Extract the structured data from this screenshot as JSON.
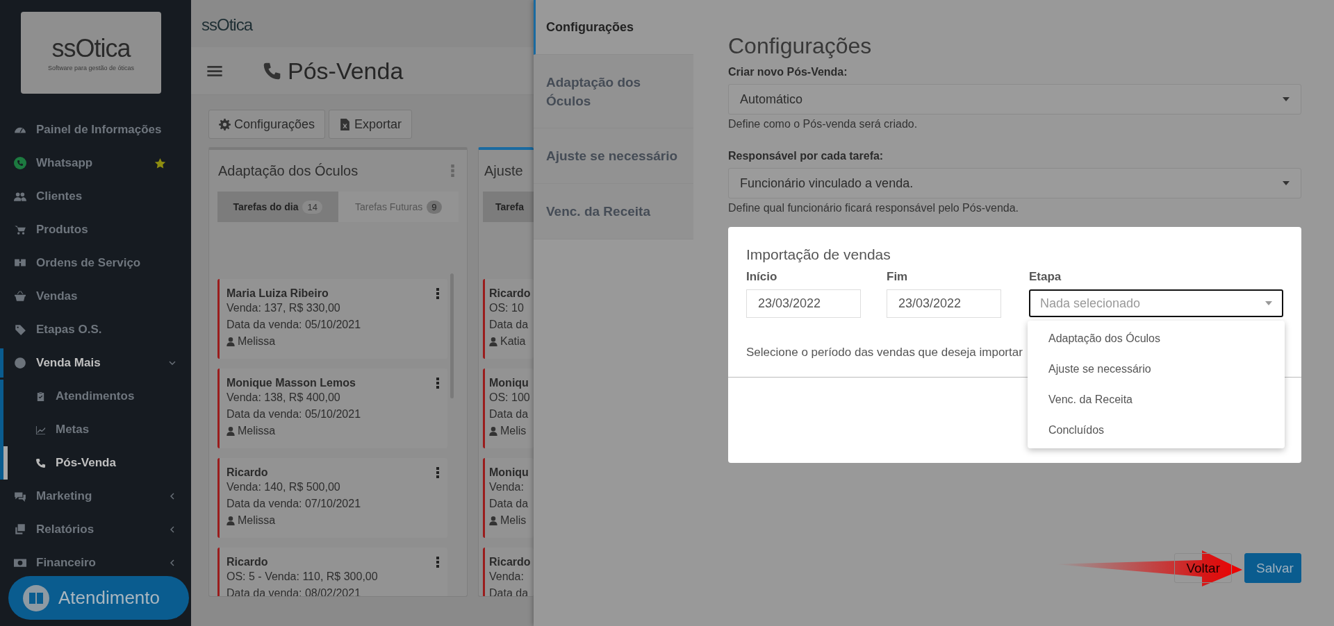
{
  "sidebar": {
    "logo": {
      "name": "ssOtica",
      "tagline": "Software para gestão de óticas"
    },
    "items": [
      {
        "label": "Painel de Informações",
        "kind": "link",
        "starred": false
      },
      {
        "label": "Whatsapp",
        "kind": "link",
        "starred": true
      },
      {
        "label": "Clientes",
        "kind": "link",
        "starred": false
      },
      {
        "label": "Produtos",
        "kind": "link",
        "starred": false
      },
      {
        "label": "Ordens de Serviço",
        "kind": "link",
        "starred": false
      },
      {
        "label": "Vendas",
        "kind": "link",
        "starred": false
      },
      {
        "label": "Etapas O.S.",
        "kind": "link",
        "starred": false
      },
      {
        "label": "Venda Mais",
        "kind": "group",
        "starred": false,
        "expanded": true,
        "children": [
          {
            "label": "Atendimentos",
            "selected": false
          },
          {
            "label": "Metas",
            "selected": false
          },
          {
            "label": "Pós-Venda",
            "selected": true
          }
        ]
      },
      {
        "label": "Marketing",
        "kind": "group",
        "starred": false,
        "expanded": false
      },
      {
        "label": "Relatórios",
        "kind": "group",
        "starred": false,
        "expanded": false
      },
      {
        "label": "Financeiro",
        "kind": "group",
        "starred": false,
        "expanded": false
      }
    ],
    "support_button": {
      "label": "Atendimento"
    }
  },
  "main": {
    "logo": "ssOtica",
    "title": "Pós-Venda",
    "toolbar": [
      "Configurações",
      "Exportar"
    ],
    "columns": [
      {
        "title": "Adaptação dos Óculos",
        "selected": false,
        "tabs": [
          {
            "label": "Tarefas do dia",
            "count": "14",
            "selected": true
          },
          {
            "label": "Tarefas Futuras",
            "count": "9",
            "selected": false
          }
        ],
        "cards": [
          {
            "name": "Maria Luiza Ribeiro",
            "lines": [
              "Venda: 137, R$ 330,00",
              "Data da venda: 05/10/2021"
            ],
            "person": "Melissa"
          },
          {
            "name": "Monique Masson Lemos",
            "lines": [
              "Venda: 138, R$ 400,00",
              "Data da venda: 05/10/2021"
            ],
            "person": "Melissa"
          },
          {
            "name": "Ricardo",
            "lines": [
              "Venda: 140, R$ 500,00",
              "Data da venda: 07/10/2021"
            ],
            "person": "Melissa"
          },
          {
            "name": "Ricardo",
            "lines": [
              "OS: 5 - Venda: 110, R$ 300,00",
              "Data da venda: 08/02/2021"
            ]
          }
        ]
      },
      {
        "title": "Ajuste",
        "selected": true,
        "tabs": [
          {
            "label": "Tarefa",
            "selected": true
          }
        ],
        "cards": [
          {
            "name": "Ricardo",
            "lines": [
              "OS: 10",
              "Data da"
            ],
            "person": "Katia"
          },
          {
            "name": "Moniqu",
            "lines": [
              "OS: 100",
              "Data da"
            ],
            "person": "Melis"
          },
          {
            "name": "Moniqu",
            "lines": [
              "Venda:",
              "Data da"
            ],
            "person": "Melis"
          },
          {
            "name": "Ricardo",
            "lines": [
              "Venda:",
              "Data da"
            ]
          }
        ]
      }
    ]
  },
  "settings": {
    "tabs": [
      {
        "label": "Configurações",
        "selected": true
      },
      {
        "label": "Adaptação dos Óculos",
        "selected": false
      },
      {
        "label": "Ajuste se necessário",
        "selected": false
      },
      {
        "label": "Venc. da Receita",
        "selected": false
      }
    ],
    "title": "Configurações",
    "fields": [
      {
        "label": "Criar novo Pós-Venda:",
        "value": "Automático",
        "help": "Define como o Pós-venda será criado."
      },
      {
        "label": "Responsável por cada tarefa:",
        "value": "Funcionário vinculado a venda.",
        "help": "Define qual funcionário ficará responsável pelo Pós-venda."
      }
    ],
    "dialog": {
      "title": "Importação de vendas",
      "fields": [
        {
          "label": "Início",
          "kind": "date",
          "value": "23/03/2022"
        },
        {
          "label": "Fim",
          "kind": "date",
          "value": "23/03/2022"
        },
        {
          "label": "Etapa",
          "kind": "select",
          "placeholder": "Nada selecionado",
          "open": true,
          "options": [
            "Adaptação dos Óculos",
            "Ajuste se necessário",
            "Venc. da Receita",
            "Concluídos"
          ]
        }
      ],
      "note": "Selecione o período das vendas que deseja importar"
    },
    "buttons": [
      {
        "label": "Voltar",
        "kind": "secondary"
      },
      {
        "label": "Salvar",
        "kind": "primary"
      }
    ]
  }
}
